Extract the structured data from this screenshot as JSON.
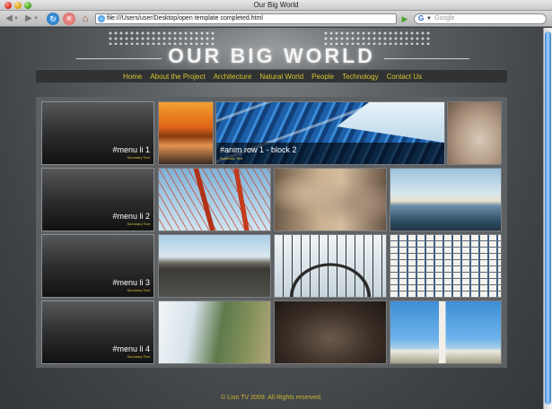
{
  "window": {
    "title": "Our Big World"
  },
  "toolbar": {
    "url": "file:///Users/user/Desktop/open template completed.html",
    "search_placeholder": "Google"
  },
  "site": {
    "title": "OUR BIG WORLD",
    "nav": [
      "Home",
      "About the Project",
      "Architecture",
      "Natural World",
      "People",
      "Technology",
      "Contact Us"
    ],
    "menu": [
      {
        "label": "#menu li 1",
        "sub": "Summary Text"
      },
      {
        "label": "#menu li 2",
        "sub": "Summary Text"
      },
      {
        "label": "#menu li 3",
        "sub": "Summary Text"
      },
      {
        "label": "#menu li 4",
        "sub": "Summary Text"
      }
    ],
    "anim": {
      "label": "#anim row 1 - block 2",
      "sub": "Summary Text"
    },
    "footer": "© Lion TV 2009. All Rights reserved."
  },
  "colors": {
    "nav_text": "#d3c52e",
    "footer_text": "#c9b733",
    "accent_blue": "#3f86d3"
  },
  "icons": {
    "back": "left-arrow-icon",
    "forward": "right-arrow-icon",
    "reload": "reload-icon",
    "stop": "stop-icon",
    "home": "home-icon",
    "go": "go-arrow-icon",
    "search": "google-search-icon"
  }
}
